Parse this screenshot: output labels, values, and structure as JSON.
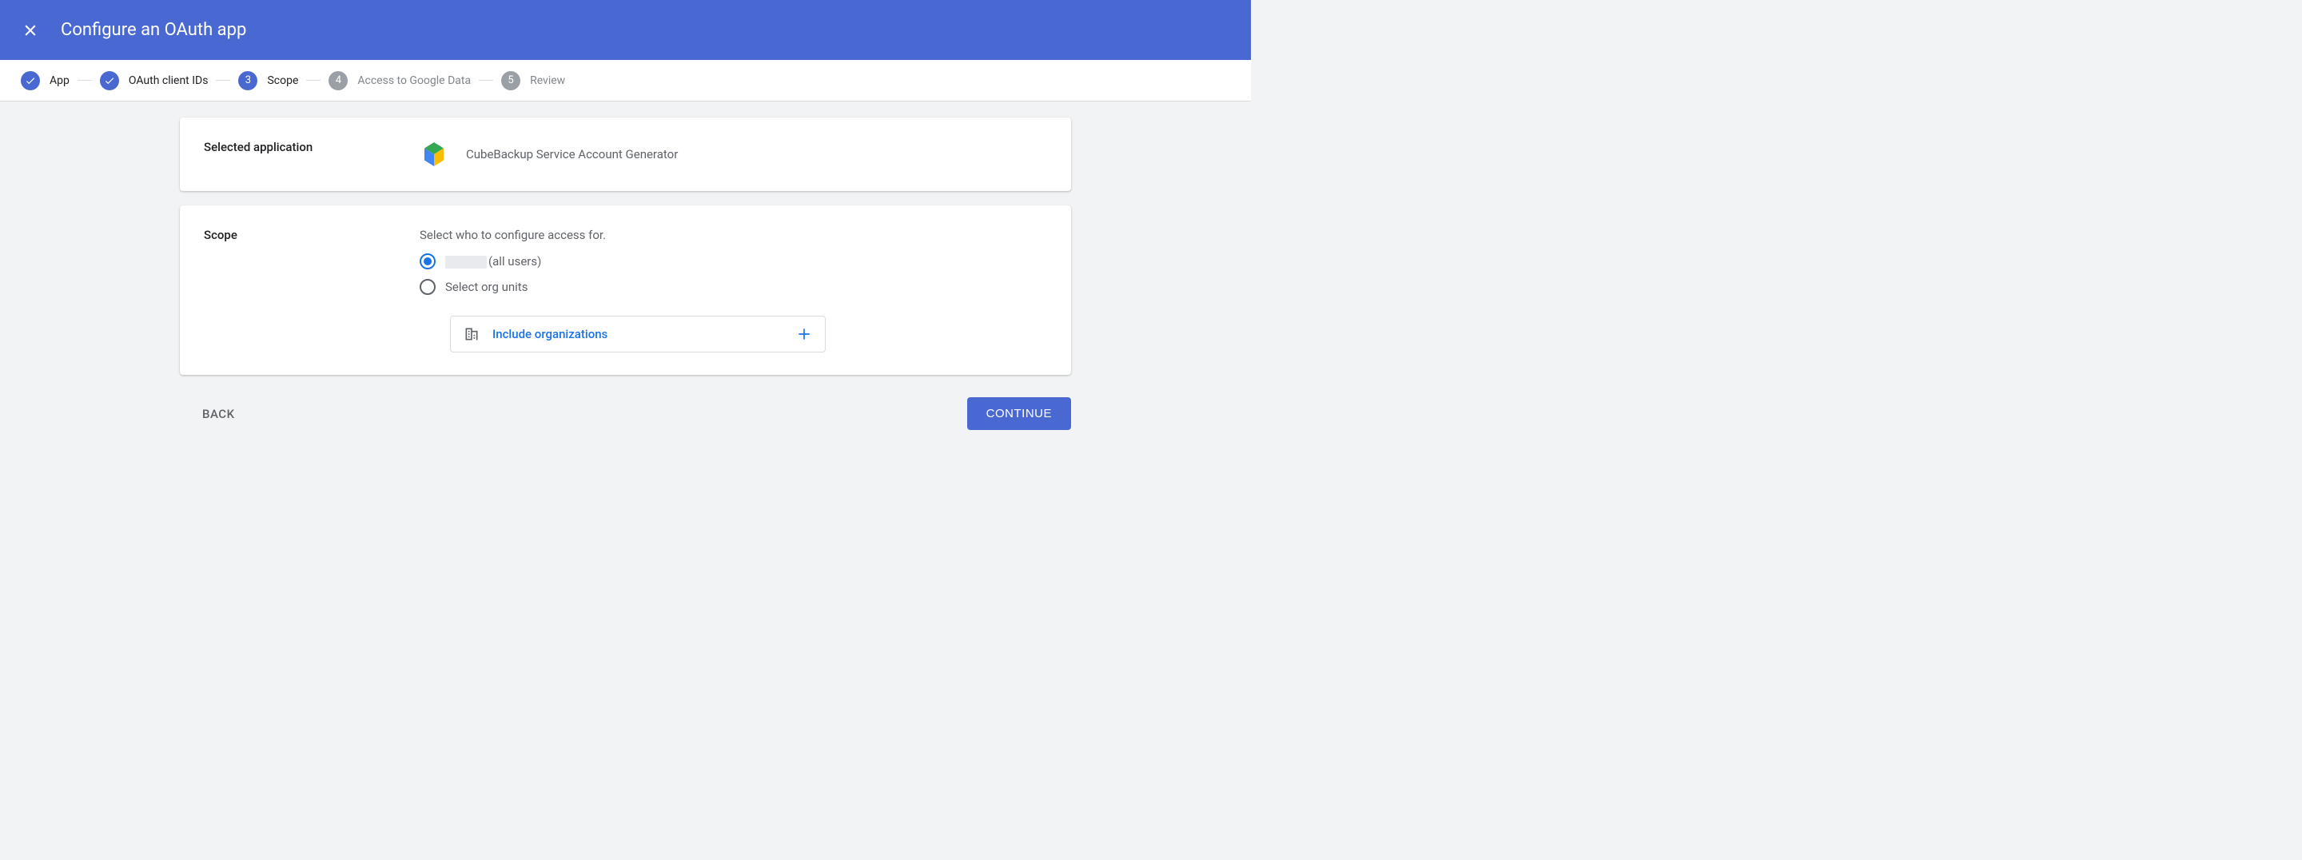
{
  "header": {
    "title": "Configure an OAuth app"
  },
  "stepper": {
    "steps": [
      {
        "label": "App",
        "state": "done"
      },
      {
        "label": "OAuth client IDs",
        "state": "done"
      },
      {
        "label": "Scope",
        "state": "active",
        "num": "3"
      },
      {
        "label": "Access to Google Data",
        "state": "pending",
        "num": "4"
      },
      {
        "label": "Review",
        "state": "pending",
        "num": "5"
      }
    ]
  },
  "selected_app": {
    "label": "Selected application",
    "name": "CubeBackup Service Account Generator"
  },
  "scope": {
    "label": "Scope",
    "hint": "Select who to configure access for.",
    "option_all_suffix": "(all users)",
    "option_org": "Select org units",
    "include_label": "Include organizations"
  },
  "buttons": {
    "back": "BACK",
    "continue": "CONTINUE"
  }
}
